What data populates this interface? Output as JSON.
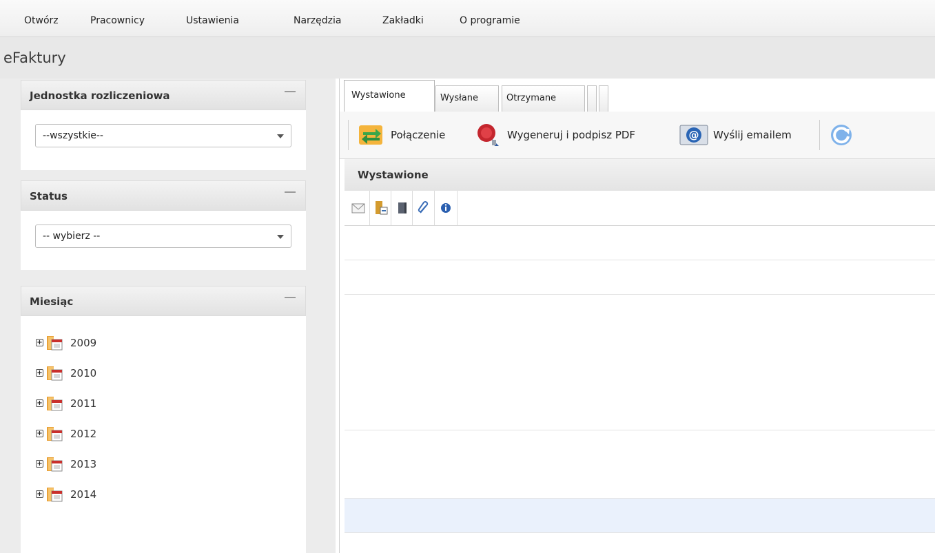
{
  "menu": [
    "Otwórz",
    "Pracownicy",
    "Ustawienia",
    "Narzędzia",
    "Zakładki",
    "O programie"
  ],
  "app_title": "eFaktury",
  "left_panel": {
    "unit": {
      "title": "Jednostka rozliczeniowa",
      "selected": "--wszystkie--"
    },
    "status": {
      "title": "Status",
      "selected": "-- wybierz --"
    },
    "month": {
      "title": "Miesiąc",
      "years": [
        "2009",
        "2010",
        "2011",
        "2012",
        "2013",
        "2014"
      ]
    }
  },
  "tabs": [
    "Wystawione",
    "Wysłane",
    "Otrzymane"
  ],
  "toolbar": {
    "connect": "Połączenie",
    "sign_pdf": "Wygeneruj i podpisz PDF",
    "send_email": "Wyślij emailem"
  },
  "grid": {
    "title": "Wystawione",
    "row_count": 9,
    "selected_row": 8
  },
  "colors": {
    "selected_row": "#eaf1fc",
    "panel_bg": "#ececec"
  },
  "icons": {
    "grid_toolbar": [
      "envelope-icon",
      "book-export-icon",
      "book-icon",
      "paperclip-icon",
      "info-icon"
    ],
    "toolbar": [
      "connection-arrows-icon",
      "wax-seal-icon",
      "email-at-icon",
      "refresh-icon"
    ]
  }
}
